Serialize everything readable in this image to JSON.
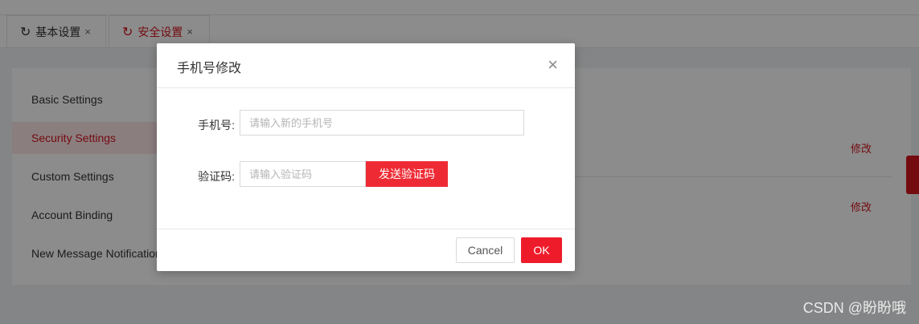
{
  "tabs": [
    {
      "label": "基本设置",
      "close": "×",
      "icon": "refresh-icon"
    },
    {
      "label": "安全设置",
      "close": "×",
      "icon": "refresh-icon"
    }
  ],
  "menu": {
    "items": [
      {
        "label": "Basic Settings"
      },
      {
        "label": "Security Settings"
      },
      {
        "label": "Custom Settings"
      },
      {
        "label": "Account Binding"
      },
      {
        "label": "New Message Notification"
      }
    ],
    "active_index": 1
  },
  "content": {
    "modify_links": [
      "修改",
      "修改"
    ]
  },
  "modal": {
    "title": "手机号修改",
    "close_icon": "×",
    "phone": {
      "label": "手机号:",
      "placeholder": "请输入新的手机号",
      "value": ""
    },
    "code": {
      "label": "验证码:",
      "placeholder": "请输入验证码",
      "value": ""
    },
    "send_code_label": "发送验证码",
    "cancel_label": "Cancel",
    "ok_label": "OK"
  },
  "watermark": "CSDN @盼盼哦",
  "colors": {
    "accent": "#d4141e",
    "button_red": "#ee1c2b",
    "active_bg": "#fde6e7"
  }
}
